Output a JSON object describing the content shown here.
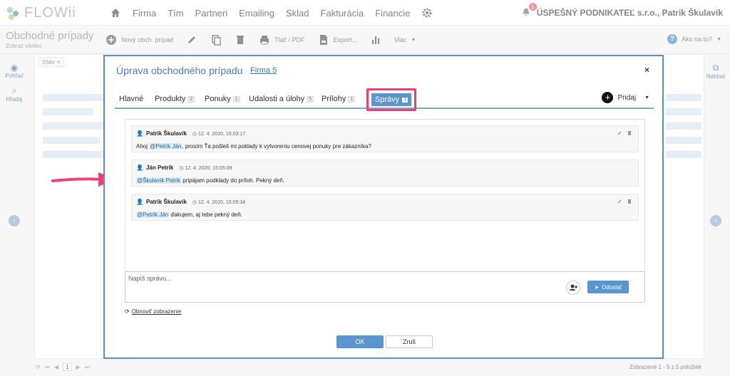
{
  "brand": {
    "name": "FLOWii"
  },
  "nav": {
    "items": [
      "Firma",
      "Tím",
      "Partneri",
      "Emailing",
      "Sklad",
      "Fakturácia",
      "Financie"
    ],
    "notifications_count": "1",
    "company": "ÚSPEŠNÝ PODNIKATEĽ s.r.o., Patrik Škulavík"
  },
  "toolbar": {
    "title": "Obchodné prípady",
    "subtitle": "Zobraz všetko",
    "new_label": "Nový obch. prípad",
    "print_label": "Tlač / PDF",
    "export_label": "Export...",
    "more_label": "Viac",
    "help_label": "Ako na to?"
  },
  "rails": {
    "view_label": "Pohľad",
    "search_label": "Hľadaj",
    "preview_label": "Náhľad"
  },
  "background": {
    "filter_chip": "Stav"
  },
  "bottom": {
    "page": "1",
    "totals": "Zobrazené 1 - 5 z 5 položiek"
  },
  "modal": {
    "title": "Úprava obchodného prípadu",
    "link": "Firma 5",
    "close": "×",
    "tabs": [
      {
        "label": "Hlavné",
        "count": ""
      },
      {
        "label": "Produkty",
        "count": "2"
      },
      {
        "label": "Ponuky",
        "count": "1"
      },
      {
        "label": "Udalosti a úlohy",
        "count": "5"
      },
      {
        "label": "Prílohy",
        "count": "1"
      }
    ],
    "active_tab": {
      "label": "Správy",
      "count": "3"
    },
    "add_label": "Pridaj",
    "messages": [
      {
        "author": "Patrik Škulavík",
        "time": "12. 4. 2020, 15:03:17",
        "pre": "Ahoj ",
        "mention": "@Petrík Ján",
        "post": ", prosím Ťa pošleš mi poklady k vytvoreniu cenovej ponuky pre zákazníka?"
      },
      {
        "author": "Ján Petrík",
        "time": "12. 4. 2020, 15:05:09",
        "pre": "",
        "mention": "@Škulavík Patrik",
        "post": " pripájam podklady do príloh. Pekný deň."
      },
      {
        "author": "Patrik Škulavík",
        "time": "12. 4. 2020, 15:05:34",
        "pre": "",
        "mention": "@Petrík Ján",
        "post": " ďakujem, aj tebe pekný deň."
      }
    ],
    "compose_placeholder": "Napíš správu...",
    "send_label": "Odoslať",
    "refresh_label": "Obnoviť zobrazenie",
    "ok_label": "OK",
    "cancel_label": "Zruš"
  },
  "colors": {
    "accent": "#5b95cf",
    "highlight": "#e8417e",
    "mention_bg": "#d9ecf7"
  }
}
